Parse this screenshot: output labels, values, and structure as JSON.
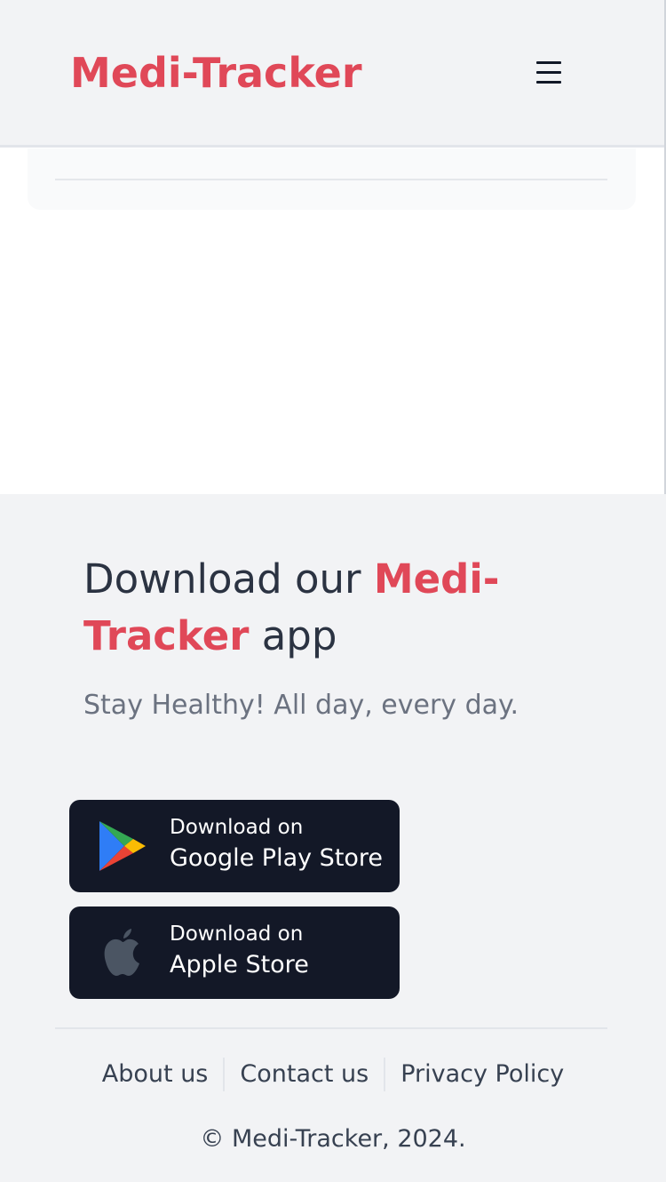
{
  "header": {
    "brand": "Medi-Tracker",
    "menu_icon": "hamburger-menu-icon"
  },
  "footer": {
    "headline": {
      "prefix": "Download our ",
      "accent": "Medi-Tracker",
      "suffix": " app"
    },
    "tagline": "Stay Healthy! All day, every day.",
    "stores": [
      {
        "small": "Download on",
        "big": "Google Play Store",
        "icon": "google-play-icon"
      },
      {
        "small": "Download on",
        "big": "Apple Store",
        "icon": "apple-icon"
      }
    ],
    "links": [
      "About us",
      "Contact us",
      "Privacy Policy"
    ],
    "copyright": "© Medi-Tracker, 2024."
  },
  "colors": {
    "brand": "#e04858",
    "button_bg": "#131827",
    "footer_bg": "#f2f3f5"
  }
}
